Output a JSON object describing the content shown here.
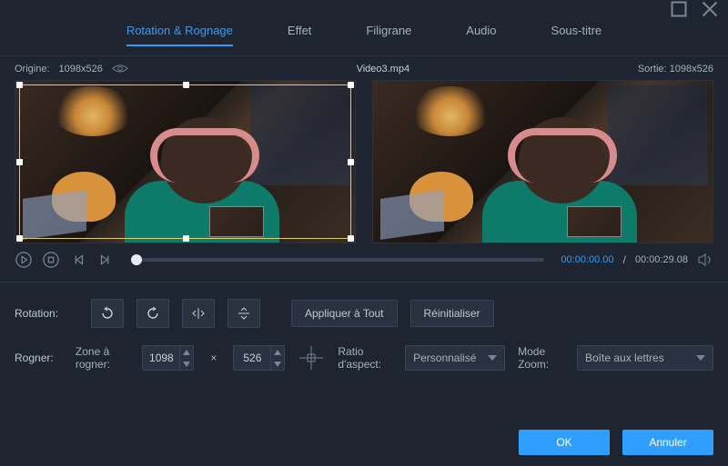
{
  "tabs": {
    "rotation": "Rotation & Rognage",
    "effect": "Effet",
    "watermark": "Filigrane",
    "audio": "Audio",
    "subtitle": "Sous-titre"
  },
  "info": {
    "origin_label": "Origine:",
    "origin_dims": "1098x526",
    "filename": "Video3.mp4",
    "output_label": "Sortie:",
    "output_dims": "1098x526"
  },
  "time": {
    "current": "00:00:00.00",
    "total": "00:00:29.08"
  },
  "rotation": {
    "label": "Rotation:",
    "apply_all": "Appliquer à Tout",
    "reset": "Réinitialiser"
  },
  "crop": {
    "label": "Rogner:",
    "area_label": "Zone à rogner:",
    "width": "1098",
    "height": "526",
    "ratio_label": "Ratio d'aspect:",
    "ratio_value": "Personnalisé",
    "zoom_label": "Mode Zoom:",
    "zoom_value": "Boîte aux lettres"
  },
  "footer": {
    "ok": "OK",
    "cancel": "Annuler"
  }
}
